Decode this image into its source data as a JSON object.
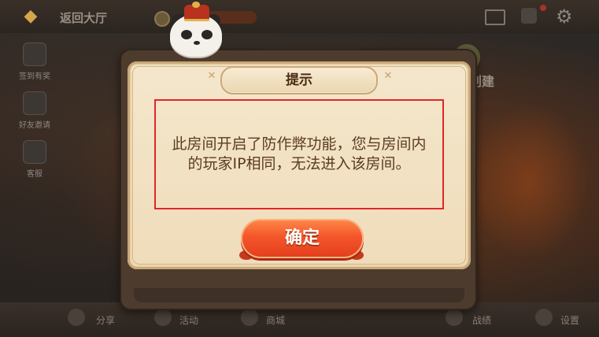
{
  "header": {
    "back_label": "返回大厅",
    "back_icon": "◆"
  },
  "sidebar": {
    "items": [
      {
        "label": "签到有奖"
      },
      {
        "label": "好友邀请"
      },
      {
        "label": "客服"
      }
    ]
  },
  "background": {
    "right_label": "创建",
    "bottom_items": [
      "分享",
      "活动",
      "商城",
      "战绩",
      "设置"
    ]
  },
  "dialog": {
    "title": "提示",
    "message": "此房间开启了防作弊功能，您与房间内的玩家IP相同，无法进入该房间。",
    "confirm_label": "确定",
    "corner_glyph": "✕"
  },
  "colors": {
    "highlight_border": "#e0262a",
    "button_orange": "#f4562a",
    "dialog_bg": "#f5e7cc"
  }
}
